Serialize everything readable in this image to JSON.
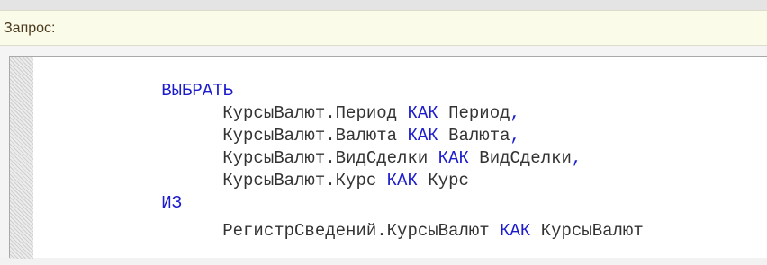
{
  "label": "Запрос:",
  "colors": {
    "keyword": "#1c1ccc",
    "identifier": "#333333",
    "label_panel_bg": "#fbfbe9",
    "label_text": "#4a3a1e"
  },
  "query": {
    "select_keyword": "ВЫБРАТЬ",
    "fields": [
      {
        "source": "КурсыВалют.Период",
        "as": "КАК",
        "alias": "Период",
        "sep": ","
      },
      {
        "source": "КурсыВалют.Валюта",
        "as": "КАК",
        "alias": "Валюта",
        "sep": ","
      },
      {
        "source": "КурсыВалют.ВидСделки",
        "as": "КАК",
        "alias": "ВидСделки",
        "sep": ","
      },
      {
        "source": "КурсыВалют.Курс",
        "as": "КАК",
        "alias": "Курс",
        "sep": ""
      }
    ],
    "from_keyword": "ИЗ",
    "from": {
      "source": "РегистрСведений.КурсыВалют",
      "as": "КАК",
      "alias": "КурсыВалют"
    }
  }
}
